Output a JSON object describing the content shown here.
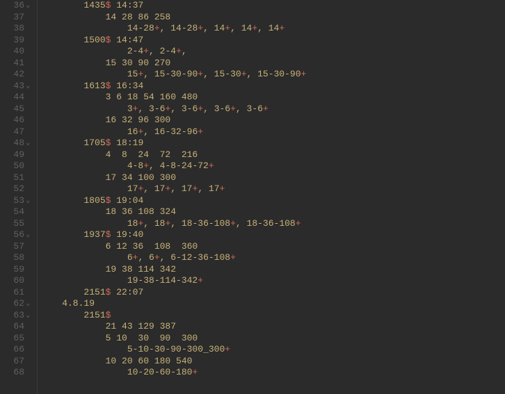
{
  "editor": {
    "lines": [
      {
        "num": 36,
        "fold": true,
        "segs": [
          {
            "t": "        1435",
            "c": "y"
          },
          {
            "t": "$",
            "c": "r"
          },
          {
            "t": " 14:37",
            "c": "y"
          }
        ]
      },
      {
        "num": 37,
        "fold": false,
        "segs": [
          {
            "t": "            14 28 86 258",
            "c": "y"
          }
        ]
      },
      {
        "num": 38,
        "fold": false,
        "segs": [
          {
            "t": "                14-28",
            "c": "y"
          },
          {
            "t": "+",
            "c": "r"
          },
          {
            "t": ", 14-28",
            "c": "y"
          },
          {
            "t": "+",
            "c": "r"
          },
          {
            "t": ", 14",
            "c": "y"
          },
          {
            "t": "+",
            "c": "r"
          },
          {
            "t": ", 14",
            "c": "y"
          },
          {
            "t": "+",
            "c": "r"
          },
          {
            "t": ", 14",
            "c": "y"
          },
          {
            "t": "+",
            "c": "r"
          }
        ]
      },
      {
        "num": 39,
        "fold": false,
        "segs": [
          {
            "t": "        1500",
            "c": "y"
          },
          {
            "t": "$",
            "c": "r"
          },
          {
            "t": " 14:47",
            "c": "y"
          }
        ]
      },
      {
        "num": 40,
        "fold": false,
        "segs": [
          {
            "t": "                2-4",
            "c": "y"
          },
          {
            "t": "+",
            "c": "r"
          },
          {
            "t": ", 2-4",
            "c": "y"
          },
          {
            "t": "+",
            "c": "r"
          },
          {
            "t": ",",
            "c": "y"
          }
        ]
      },
      {
        "num": 41,
        "fold": false,
        "segs": [
          {
            "t": "            15 30 90 270",
            "c": "y"
          }
        ]
      },
      {
        "num": 42,
        "fold": false,
        "segs": [
          {
            "t": "                15",
            "c": "y"
          },
          {
            "t": "+",
            "c": "r"
          },
          {
            "t": ", 15-30-90",
            "c": "y"
          },
          {
            "t": "+",
            "c": "r"
          },
          {
            "t": ", 15-30",
            "c": "y"
          },
          {
            "t": "+",
            "c": "r"
          },
          {
            "t": ", 15-30-90",
            "c": "y"
          },
          {
            "t": "+",
            "c": "r"
          }
        ]
      },
      {
        "num": 43,
        "fold": true,
        "segs": [
          {
            "t": "        1613",
            "c": "y"
          },
          {
            "t": "$",
            "c": "r"
          },
          {
            "t": " 16:34",
            "c": "y"
          }
        ]
      },
      {
        "num": 44,
        "fold": false,
        "segs": [
          {
            "t": "            3 6 18 54 160 480",
            "c": "y"
          }
        ]
      },
      {
        "num": 45,
        "fold": false,
        "segs": [
          {
            "t": "                3",
            "c": "y"
          },
          {
            "t": "+",
            "c": "r"
          },
          {
            "t": ", 3-6",
            "c": "y"
          },
          {
            "t": "+",
            "c": "r"
          },
          {
            "t": ", 3-6",
            "c": "y"
          },
          {
            "t": "+",
            "c": "r"
          },
          {
            "t": ", 3-6",
            "c": "y"
          },
          {
            "t": "+",
            "c": "r"
          },
          {
            "t": ", 3-6",
            "c": "y"
          },
          {
            "t": "+",
            "c": "r"
          }
        ]
      },
      {
        "num": 46,
        "fold": false,
        "segs": [
          {
            "t": "            16 32 96 300",
            "c": "y"
          }
        ]
      },
      {
        "num": 47,
        "fold": false,
        "segs": [
          {
            "t": "                16",
            "c": "y"
          },
          {
            "t": "+",
            "c": "r"
          },
          {
            "t": ", 16-32-96",
            "c": "y"
          },
          {
            "t": "+",
            "c": "r"
          }
        ]
      },
      {
        "num": 48,
        "fold": true,
        "segs": [
          {
            "t": "        1705",
            "c": "y"
          },
          {
            "t": "$",
            "c": "r"
          },
          {
            "t": " 18:19",
            "c": "y"
          }
        ]
      },
      {
        "num": 49,
        "fold": false,
        "segs": [
          {
            "t": "            4  8  24  72  216",
            "c": "y"
          }
        ]
      },
      {
        "num": 50,
        "fold": false,
        "segs": [
          {
            "t": "                4-8",
            "c": "y"
          },
          {
            "t": "+",
            "c": "r"
          },
          {
            "t": ", 4-8-24-72",
            "c": "y"
          },
          {
            "t": "+",
            "c": "r"
          }
        ]
      },
      {
        "num": 51,
        "fold": false,
        "segs": [
          {
            "t": "            17 34 100 300",
            "c": "y"
          }
        ]
      },
      {
        "num": 52,
        "fold": false,
        "segs": [
          {
            "t": "                17",
            "c": "y"
          },
          {
            "t": "+",
            "c": "r"
          },
          {
            "t": ", 17",
            "c": "y"
          },
          {
            "t": "+",
            "c": "r"
          },
          {
            "t": ", 17",
            "c": "y"
          },
          {
            "t": "+",
            "c": "r"
          },
          {
            "t": ", 17",
            "c": "y"
          },
          {
            "t": "+",
            "c": "r"
          }
        ]
      },
      {
        "num": 53,
        "fold": true,
        "segs": [
          {
            "t": "        1805",
            "c": "y"
          },
          {
            "t": "$",
            "c": "r"
          },
          {
            "t": " 19:04",
            "c": "y"
          }
        ]
      },
      {
        "num": 54,
        "fold": false,
        "segs": [
          {
            "t": "            18 36 108 324",
            "c": "y"
          }
        ]
      },
      {
        "num": 55,
        "fold": false,
        "segs": [
          {
            "t": "                18",
            "c": "y"
          },
          {
            "t": "+",
            "c": "r"
          },
          {
            "t": ", 18",
            "c": "y"
          },
          {
            "t": "+",
            "c": "r"
          },
          {
            "t": ", 18-36-108",
            "c": "y"
          },
          {
            "t": "+",
            "c": "r"
          },
          {
            "t": ", 18-36-108",
            "c": "y"
          },
          {
            "t": "+",
            "c": "r"
          }
        ]
      },
      {
        "num": 56,
        "fold": true,
        "segs": [
          {
            "t": "        1937",
            "c": "y"
          },
          {
            "t": "$",
            "c": "r"
          },
          {
            "t": " 19:40",
            "c": "y"
          }
        ]
      },
      {
        "num": 57,
        "fold": false,
        "segs": [
          {
            "t": "            6 12 36  108  360",
            "c": "y"
          }
        ]
      },
      {
        "num": 58,
        "fold": false,
        "segs": [
          {
            "t": "                6",
            "c": "y"
          },
          {
            "t": "+",
            "c": "r"
          },
          {
            "t": ", 6",
            "c": "y"
          },
          {
            "t": "+",
            "c": "r"
          },
          {
            "t": ", 6-12-36-108",
            "c": "y"
          },
          {
            "t": "+",
            "c": "r"
          }
        ]
      },
      {
        "num": 59,
        "fold": false,
        "segs": [
          {
            "t": "            19 38 114 342",
            "c": "y"
          }
        ]
      },
      {
        "num": 60,
        "fold": false,
        "segs": [
          {
            "t": "                19-38-114-342",
            "c": "y"
          },
          {
            "t": "+",
            "c": "r"
          }
        ]
      },
      {
        "num": 61,
        "fold": false,
        "segs": [
          {
            "t": "        2151",
            "c": "y"
          },
          {
            "t": "$",
            "c": "r"
          },
          {
            "t": " 22:07",
            "c": "y"
          }
        ]
      },
      {
        "num": 62,
        "fold": true,
        "segs": [
          {
            "t": "    4.8.19",
            "c": "y"
          }
        ]
      },
      {
        "num": 63,
        "fold": true,
        "segs": [
          {
            "t": "        2151",
            "c": "y"
          },
          {
            "t": "$",
            "c": "r"
          }
        ]
      },
      {
        "num": 64,
        "fold": false,
        "segs": [
          {
            "t": "            21 43 129 387",
            "c": "y"
          }
        ]
      },
      {
        "num": 65,
        "fold": false,
        "segs": [
          {
            "t": "            5 10  30  90  300",
            "c": "y"
          }
        ]
      },
      {
        "num": 66,
        "fold": false,
        "segs": [
          {
            "t": "                5-10-30-90-300_300",
            "c": "y"
          },
          {
            "t": "+",
            "c": "r"
          }
        ]
      },
      {
        "num": 67,
        "fold": false,
        "segs": [
          {
            "t": "            10 20 60 180 540",
            "c": "y"
          }
        ]
      },
      {
        "num": 68,
        "fold": false,
        "segs": [
          {
            "t": "                10-20-60-180",
            "c": "y"
          },
          {
            "t": "+",
            "c": "r"
          }
        ]
      }
    ]
  }
}
